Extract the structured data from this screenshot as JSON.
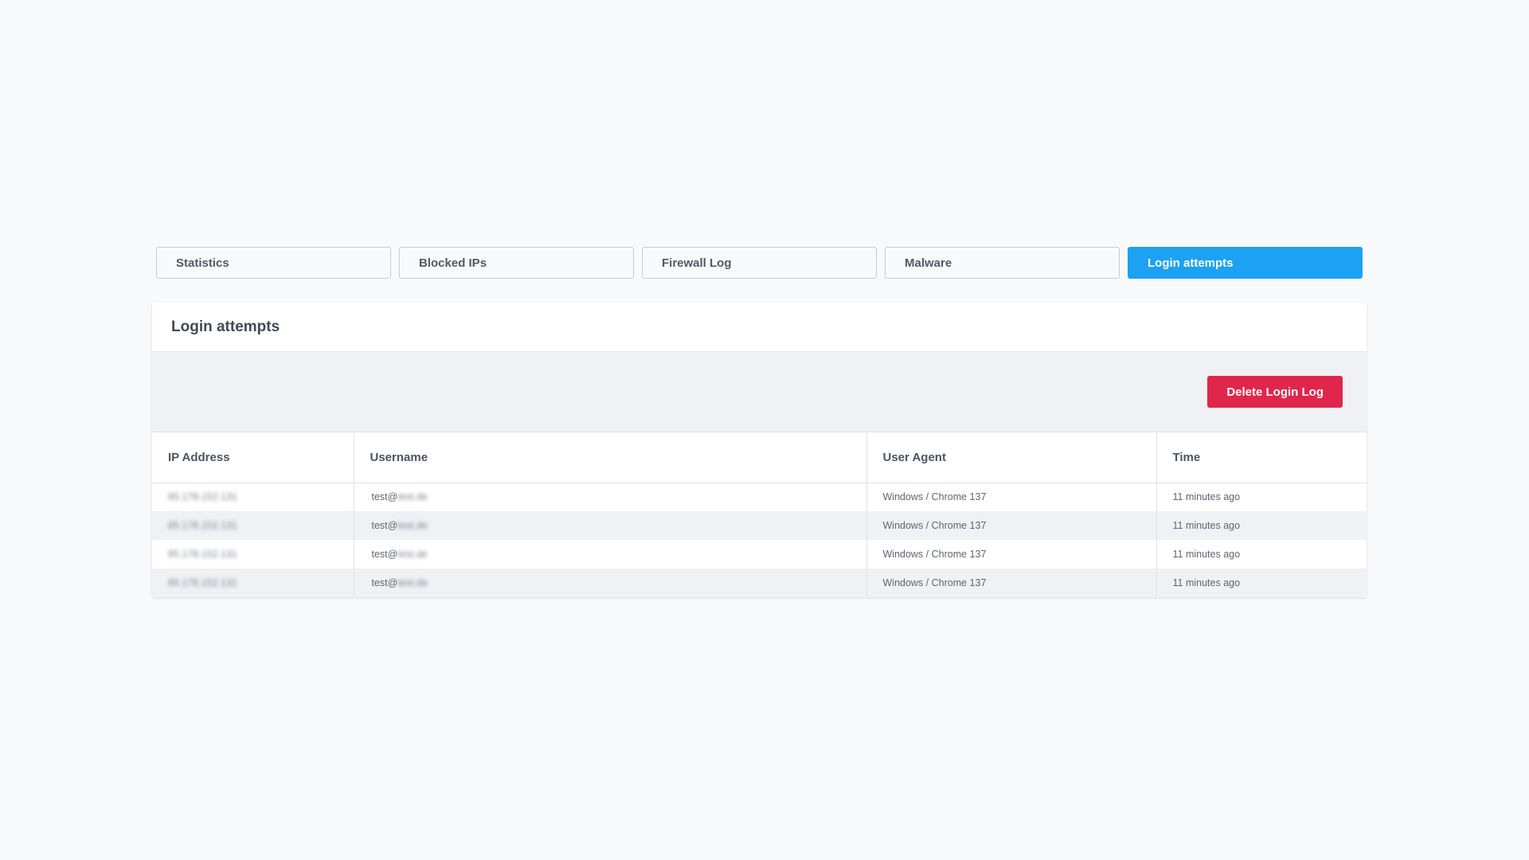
{
  "tabs": [
    {
      "label": "Statistics",
      "active": false
    },
    {
      "label": "Blocked IPs",
      "active": false
    },
    {
      "label": "Firewall Log",
      "active": false
    },
    {
      "label": "Malware",
      "active": false
    },
    {
      "label": "Login attempts",
      "active": true
    }
  ],
  "panel": {
    "title": "Login attempts",
    "delete_label": "Delete Login Log"
  },
  "table": {
    "headers": [
      "IP Address",
      "Username",
      "User Agent",
      "Time"
    ],
    "rows": [
      {
        "ip": "85.178.152.131",
        "user_prefix": "test@",
        "user_domain": "test.de",
        "agent": "Windows / Chrome 137",
        "time": "11 minutes ago"
      },
      {
        "ip": "85.178.152.131",
        "user_prefix": "test@",
        "user_domain": "test.de",
        "agent": "Windows / Chrome 137",
        "time": "11 minutes ago"
      },
      {
        "ip": "85.178.152.131",
        "user_prefix": "test@",
        "user_domain": "test.de",
        "agent": "Windows / Chrome 137",
        "time": "11 minutes ago"
      },
      {
        "ip": "85.178.152.131",
        "user_prefix": "test@",
        "user_domain": "test.de",
        "agent": "Windows / Chrome 137",
        "time": "11 minutes ago"
      }
    ]
  },
  "colors": {
    "active_tab": "#1da1f2",
    "danger": "#e0264b"
  }
}
